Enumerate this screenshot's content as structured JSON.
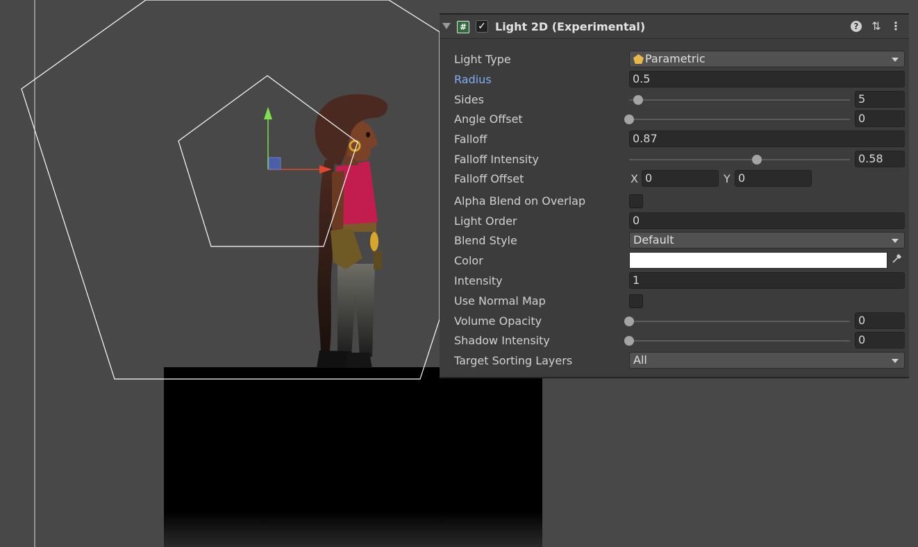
{
  "component": {
    "title": "Light 2D (Experimental)",
    "enabled": true,
    "icons": {
      "script": "script-icon",
      "help": "help-icon",
      "presets": "presets-icon",
      "menu": "more-vert-icon"
    },
    "help_glyph": "?",
    "script_glyph": "#",
    "check_glyph": "✓",
    "preset_glyph": "⇅",
    "more_glyph": "⋮"
  },
  "properties": {
    "light_type": {
      "label": "Light Type",
      "value": "Parametric"
    },
    "radius": {
      "label": "Radius",
      "value": "0.5"
    },
    "sides": {
      "label": "Sides",
      "value": "5",
      "slider_fraction": 0.04
    },
    "angle_offset": {
      "label": "Angle Offset",
      "value": "0",
      "slider_fraction": 0.0
    },
    "falloff": {
      "label": "Falloff",
      "value": "0.87"
    },
    "falloff_intensity": {
      "label": "Falloff Intensity",
      "value": "0.58",
      "slider_fraction": 0.58
    },
    "falloff_offset": {
      "label": "Falloff Offset",
      "x_label": "X",
      "x_value": "0",
      "y_label": "Y",
      "y_value": "0"
    },
    "alpha_blend": {
      "label": "Alpha Blend on Overlap",
      "checked": false
    },
    "light_order": {
      "label": "Light Order",
      "value": "0"
    },
    "blend_style": {
      "label": "Blend Style",
      "value": "Default"
    },
    "color": {
      "label": "Color",
      "value": "#FFFFFF"
    },
    "intensity": {
      "label": "Intensity",
      "value": "1"
    },
    "use_normal_map": {
      "label": "Use Normal Map",
      "checked": false
    },
    "volume_opacity": {
      "label": "Volume Opacity",
      "value": "0",
      "slider_fraction": 0.0
    },
    "shadow_intensity": {
      "label": "Shadow Intensity",
      "value": "0",
      "slider_fraction": 0.0
    },
    "target_sorting_layers": {
      "label": "Target Sorting Layers",
      "value": "All"
    }
  },
  "colors": {
    "scene_bg": "#484848",
    "inspector_bg": "#3c3c3c",
    "highlight_label": "#7faef6",
    "gizmo_outline": "#ffffff",
    "axis_y": "#7ee04a",
    "axis_x": "#e2492c",
    "axis_center": "#4a5fa8",
    "shirt": "#c21d4e"
  }
}
